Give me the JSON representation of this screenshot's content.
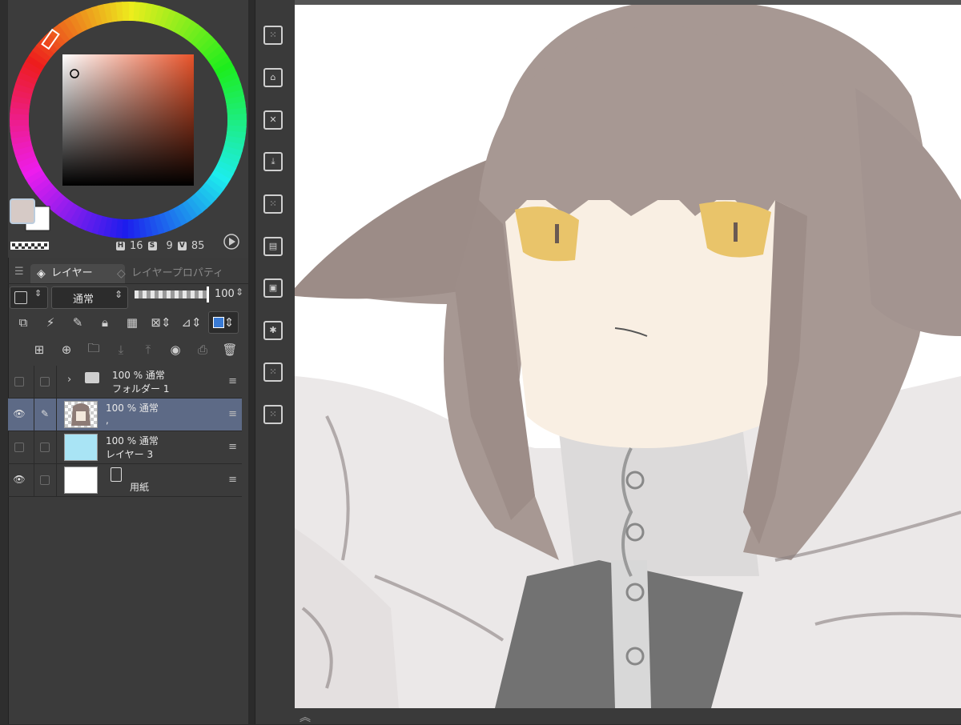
{
  "color_panel": {
    "main_color": "#d6cac6",
    "sub_color": "#ffffff",
    "h_label": "H",
    "h_value": "16",
    "s_label": "S",
    "s_value": "9",
    "v_label": "V",
    "v_value": "85"
  },
  "layer_panel": {
    "tabs": [
      {
        "label": "レイヤー",
        "active": true
      },
      {
        "label": "レイヤープロパティ",
        "active": false
      }
    ],
    "blend_mode": "通常",
    "opacity": "100",
    "layers": [
      {
        "line1": "100 % 通常",
        "line2": "フォルダー 1",
        "type": "folder",
        "visible": false,
        "selected": false
      },
      {
        "line1": "100 % 通常",
        "line2": ",",
        "type": "raster",
        "visible": true,
        "selected": true,
        "thumb": "#d8cfcf"
      },
      {
        "line1": "100 % 通常",
        "line2": "レイヤー 3",
        "type": "fill",
        "visible": false,
        "selected": false,
        "thumb": "#a9e4f5"
      },
      {
        "line1": "",
        "line2": "用紙",
        "type": "paper",
        "visible": true,
        "selected": false,
        "thumb": "#ffffff"
      }
    ]
  },
  "colors": {
    "panel_bg": "#3b3b3b",
    "selected_layer": "#5d6a86",
    "hair": "#a79893",
    "eyes": "#e9c46a",
    "skin": "#f9efe3",
    "clothing": "#e9e6e6"
  },
  "icons": {
    "visibility": "eye-icon",
    "edit": "pen-icon",
    "folder": "folder-icon",
    "paper": "paper-icon",
    "trash": "trash-icon"
  }
}
